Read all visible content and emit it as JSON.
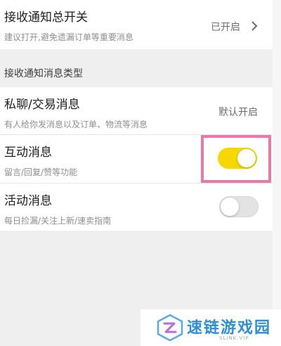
{
  "master_switch": {
    "title": "接收通知总开关",
    "description": "建议打开,避免遗漏订单等重要消息",
    "status": "已开启"
  },
  "section": {
    "title": "接收通知消息类型"
  },
  "message_types": [
    {
      "title": "私聊/交易消息",
      "description": "有人给你发消息以及订单、物流等消息",
      "status": "默认开启"
    },
    {
      "title": "互动消息",
      "description": "留言/回复/赞等功能",
      "enabled": true
    },
    {
      "title": "活动消息",
      "description": "每日捡漏/关注上新/速卖指南",
      "enabled": false
    }
  ],
  "watermark": {
    "brand": "速链游戏园",
    "domain": "SLINK.VIP"
  },
  "colors": {
    "toggle_on": "#f5d800",
    "toggle_off": "#e3e3e3",
    "highlight": "#e77aa9",
    "watermark_blue": "#2f8ed8"
  }
}
